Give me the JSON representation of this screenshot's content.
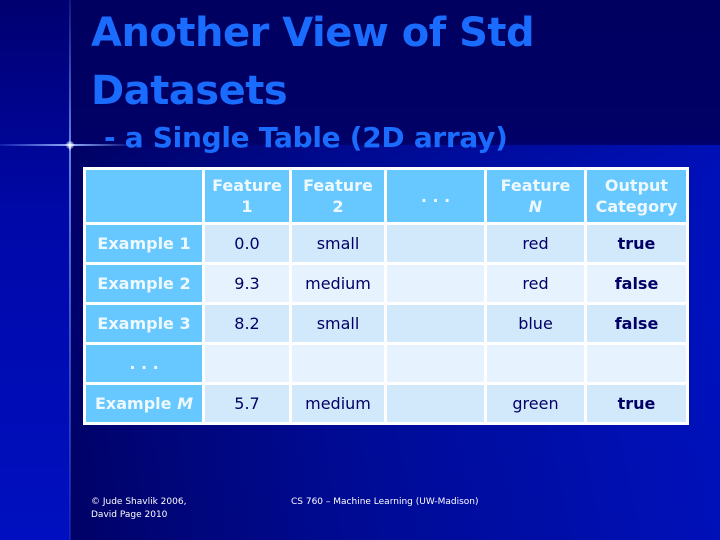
{
  "slide": {
    "title_line1": "Another View of Std",
    "title_line2": "Datasets",
    "subtitle": "- a Single Table (2D array)"
  },
  "table": {
    "headers": [
      {
        "line1": "",
        "line2": ""
      },
      {
        "line1": "Feature",
        "line2": "1"
      },
      {
        "line1": "Feature",
        "line2": "2"
      },
      {
        "line1": ". . .",
        "line2": ""
      },
      {
        "line1": "Feature",
        "line2": "N"
      },
      {
        "line1": "Output",
        "line2": "Category"
      }
    ],
    "rows": [
      {
        "label": "Example 1",
        "label_var": "",
        "cells": [
          "0.0",
          "small",
          "",
          "red",
          "true"
        ]
      },
      {
        "label": "Example 2",
        "label_var": "",
        "cells": [
          "9.3",
          "medium",
          "",
          "red",
          "false"
        ]
      },
      {
        "label": "Example 3",
        "label_var": "",
        "cells": [
          "8.2",
          "small",
          "",
          "blue",
          "false"
        ]
      },
      {
        "label": ". . .",
        "label_var": "",
        "cells": [
          "",
          "",
          "",
          "",
          ""
        ]
      },
      {
        "label": "Example ",
        "label_var": "M",
        "cells": [
          "5.7",
          "medium",
          "",
          "green",
          "true"
        ]
      }
    ]
  },
  "footer": {
    "copyright_line1": "© Jude Shavlik 2006,",
    "copyright_line2": "David Page 2010",
    "course": "CS 760 – Machine Learning (UW-Madison)"
  },
  "colors": {
    "title": "#1a6cff",
    "header_bg": "#66c8ff",
    "cell_text": "#000066",
    "background": "#000066"
  }
}
